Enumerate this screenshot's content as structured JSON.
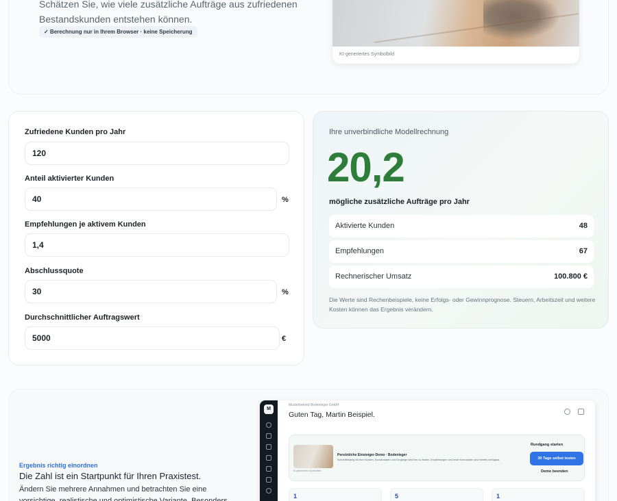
{
  "hero": {
    "text": "Schätzen Sie, wie viele zusätzliche Aufträge aus zufriedenen Bestandskunden entstehen können.",
    "privacy_badge": "✓ Berechnung nur in Ihrem Browser · keine Speicherung",
    "image_caption": "KI-generiertes Symbolbild"
  },
  "form": {
    "fields": [
      {
        "label": "Zufriedene Kunden pro Jahr",
        "value": "120",
        "unit": ""
      },
      {
        "label": "Anteil aktivierter Kunden",
        "value": "40",
        "unit": "%"
      },
      {
        "label": "Empfehlungen je aktivem Kunden",
        "value": "1,4",
        "unit": ""
      },
      {
        "label": "Abschlussquote",
        "value": "30",
        "unit": "%"
      },
      {
        "label": "Durchschnittlicher Auftragswert",
        "value": "5000",
        "unit": "€"
      }
    ]
  },
  "result": {
    "kicker": "Ihre unverbindliche Modellrechnung",
    "big_value": "20,2",
    "sub": "mögliche zusätzliche Aufträge pro Jahr",
    "rows": [
      {
        "label": "Aktivierte Kunden",
        "value": "48"
      },
      {
        "label": "Empfehlungen",
        "value": "67"
      },
      {
        "label": "Rechnerischer Umsatz",
        "value": "100.800 €"
      }
    ],
    "note": "Die Werte sind Rechenbeispiele, keine Erfolgs- oder Gewinnprognose. Steuern, Arbeitszeit und weitere Kosten können das Ergebnis verändern."
  },
  "bottom": {
    "kicker": "Ergebnis richtig einordnen",
    "heading": "Die Zahl ist ein Startpunkt für Ihren Praxistest.",
    "body": "Ändern Sie mehrere Annahmen und betrachten Sie eine vorsichtige, realistische und optimistische Variante. Besonders"
  },
  "app_preview": {
    "logo": "M",
    "company": "Musterbetrieb Bodenleger GmbH",
    "greeting": "Guten Tag, Martin Beispiel.",
    "welcome_title": "Persönliche Einsteiger-Demo · Bodenleger",
    "welcome_text": "Schnelleinstieg für Ihre Kunden, Kundendaten und Vorgänge sind hier zu finden. Empfehlungen und erste Kennzahlen sind bereits verfügbar.",
    "thumb_caption": "KI-generiertes Symbolbild",
    "tour_label": "Rundgang starten",
    "trial_label": "30 Tage selbst testen",
    "end_label": "Demo beenden",
    "stats": [
      "1",
      "5",
      "1"
    ]
  }
}
